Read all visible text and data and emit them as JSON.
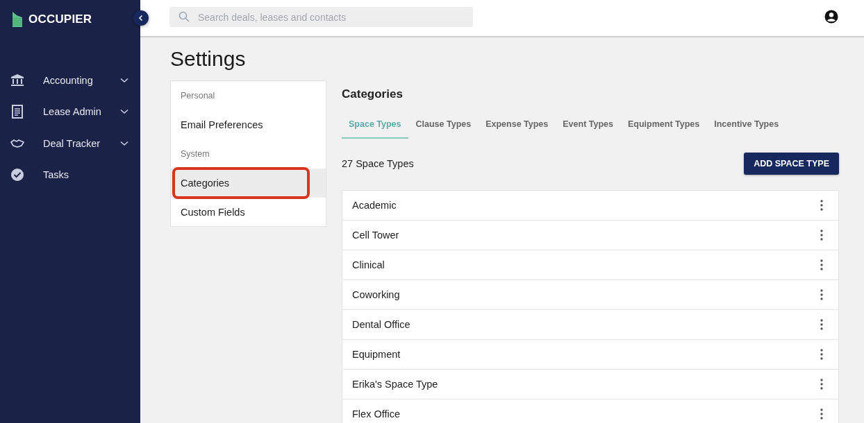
{
  "brand": {
    "name": "OCCUPIER"
  },
  "sidebar": {
    "items": [
      {
        "label": "Accounting",
        "expandable": true
      },
      {
        "label": "Lease Admin",
        "expandable": true
      },
      {
        "label": "Deal Tracker",
        "expandable": true
      },
      {
        "label": "Tasks",
        "expandable": false
      }
    ]
  },
  "search": {
    "placeholder": "Search deals, leases and contacts"
  },
  "page_title": "Settings",
  "settings_nav": [
    {
      "kind": "heading",
      "label": "Personal"
    },
    {
      "kind": "item",
      "label": "Email Preferences",
      "selected": false,
      "annotated": false
    },
    {
      "kind": "heading",
      "label": "System"
    },
    {
      "kind": "item",
      "label": "Categories",
      "selected": true,
      "annotated": true
    },
    {
      "kind": "item",
      "label": "Custom Fields",
      "selected": false,
      "annotated": false
    }
  ],
  "section_title": "Categories",
  "tabs": [
    {
      "label": "Space Types",
      "selected": true
    },
    {
      "label": "Clause Types",
      "selected": false
    },
    {
      "label": "Expense Types",
      "selected": false
    },
    {
      "label": "Event Types",
      "selected": false
    },
    {
      "label": "Equipment Types",
      "selected": false
    },
    {
      "label": "Incentive Types",
      "selected": false
    }
  ],
  "count_label": "27 Space Types",
  "add_button": "ADD SPACE TYPE",
  "rows": [
    "Academic",
    "Cell Tower",
    "Clinical",
    "Coworking",
    "Dental Office",
    "Equipment",
    "Erika's Space Type",
    "Flex Office"
  ]
}
